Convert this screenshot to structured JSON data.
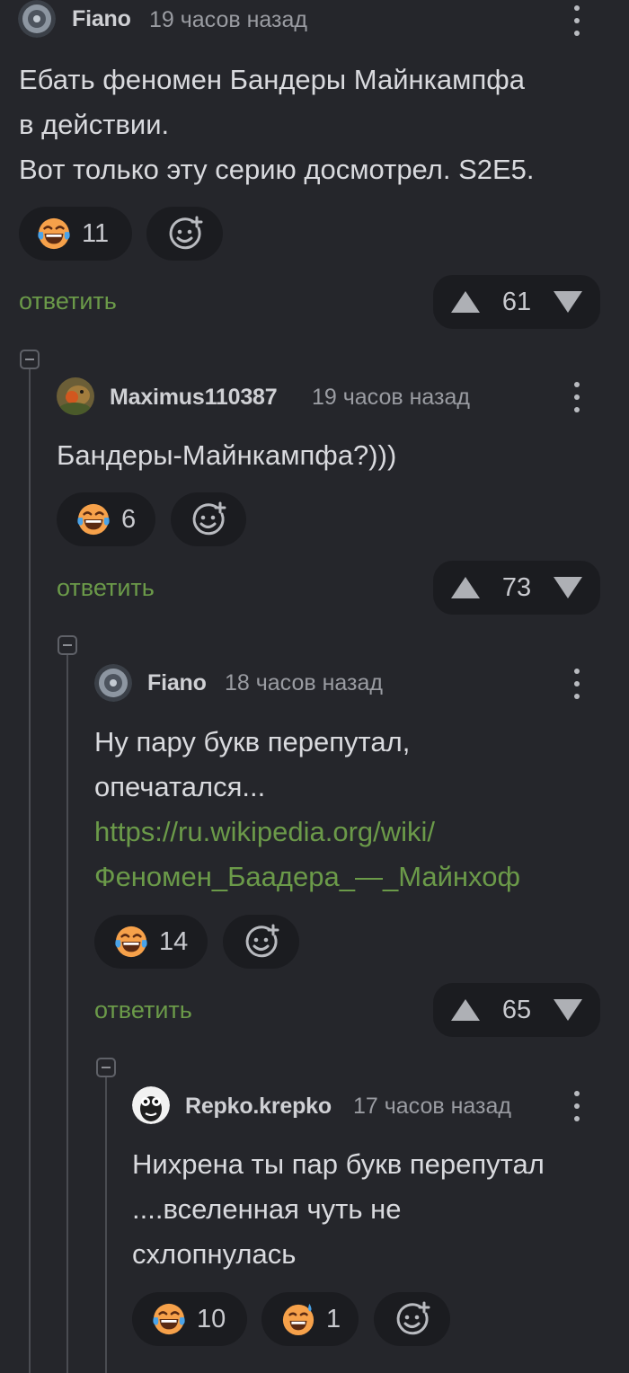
{
  "comments": [
    {
      "username": "Fiano",
      "time": "19 часов назад",
      "lines": [
        "Ебать феномен Бандеры Майнкампфа",
        "в действии.",
        "Вот только эту серию досмотрел. S2E5."
      ],
      "reactions": [
        {
          "icon": "laughing-tears-emoji-icon",
          "count": "11"
        }
      ],
      "reply_label": "ответить",
      "score": "61"
    },
    {
      "username": "Maximus110387",
      "time": "19 часов назад",
      "lines": [
        "Бандеры-Майнкампфа?)))"
      ],
      "reactions": [
        {
          "icon": "laughing-tears-emoji-icon",
          "count": "6"
        }
      ],
      "reply_label": "ответить",
      "score": "73"
    },
    {
      "username": "Fiano",
      "time": "18 часов назад",
      "lines": [
        "Ну пару букв перепутал,",
        "опечатался..."
      ],
      "link_lines": [
        "https://ru.wikipedia.org/wiki/",
        "Феномен_Баадера_—_Майнхоф"
      ],
      "reactions": [
        {
          "icon": "laughing-tears-emoji-icon",
          "count": "14"
        }
      ],
      "reply_label": "ответить",
      "score": "65"
    },
    {
      "username": "Repko.krepko",
      "time": "17 часов назад",
      "lines": [
        "Нихрена ты пар букв перепутал",
        "....вселенная чуть не",
        "схлопнулась"
      ],
      "reactions": [
        {
          "icon": "laughing-tears-emoji-icon",
          "count": "10"
        },
        {
          "icon": "grinning-sweat-emoji-icon",
          "count": "1"
        }
      ]
    }
  ],
  "colors": {
    "background": "#25262b",
    "pill": "#1b1c20",
    "link": "#6b9a49",
    "thread_line": "#4a4c52"
  }
}
